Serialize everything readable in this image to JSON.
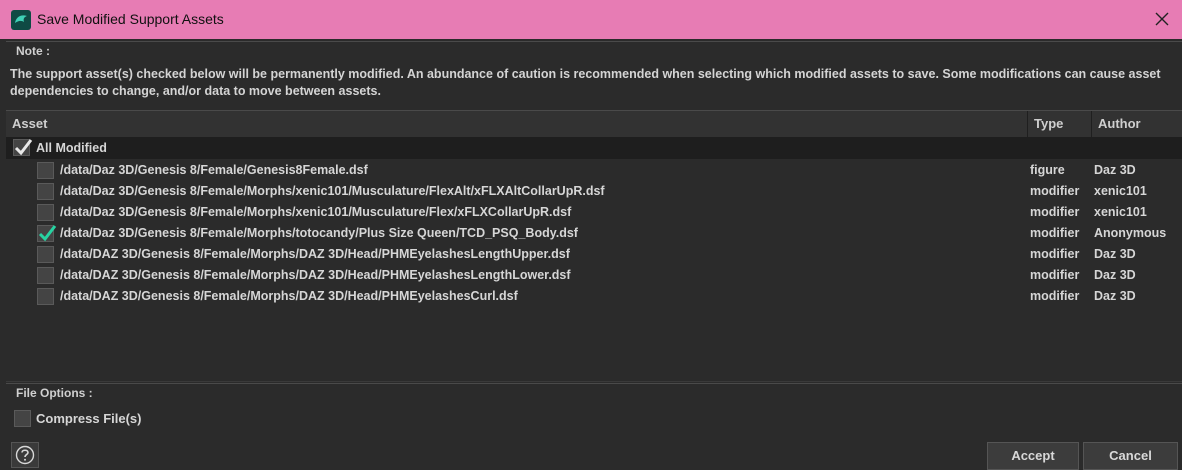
{
  "window": {
    "title": "Save Modified Support Assets",
    "close_icon": "close-icon"
  },
  "note": {
    "label": "Note :",
    "text": "The support asset(s) checked below will be permanently modified. An abundance of caution is recommended when selecting which modified assets to save. Some modifications can cause asset dependencies to change, and/or data to move between assets."
  },
  "table": {
    "headers": {
      "asset": "Asset",
      "type": "Type",
      "author": "Author"
    },
    "all_modified": {
      "label": "All Modified",
      "checked": true
    },
    "rows": [
      {
        "path": "/data/Daz 3D/Genesis 8/Female/Genesis8Female.dsf",
        "type": "figure",
        "author": "Daz 3D",
        "checked": false
      },
      {
        "path": "/data/Daz 3D/Genesis 8/Female/Morphs/xenic101/Musculature/FlexAlt/xFLXAltCollarUpR.dsf",
        "type": "modifier",
        "author": "xenic101",
        "checked": false
      },
      {
        "path": "/data/Daz 3D/Genesis 8/Female/Morphs/xenic101/Musculature/Flex/xFLXCollarUpR.dsf",
        "type": "modifier",
        "author": "xenic101",
        "checked": false
      },
      {
        "path": "/data/Daz 3D/Genesis 8/Female/Morphs/totocandy/Plus Size Queen/TCD_PSQ_Body.dsf",
        "type": "modifier",
        "author": "Anonymous",
        "checked": true
      },
      {
        "path": "/data/DAZ 3D/Genesis 8/Female/Morphs/DAZ 3D/Head/PHMEyelashesLengthUpper.dsf",
        "type": "modifier",
        "author": "Daz 3D",
        "checked": false
      },
      {
        "path": "/data/DAZ 3D/Genesis 8/Female/Morphs/DAZ 3D/Head/PHMEyelashesLengthLower.dsf",
        "type": "modifier",
        "author": "Daz 3D",
        "checked": false
      },
      {
        "path": "/data/DAZ 3D/Genesis 8/Female/Morphs/DAZ 3D/Head/PHMEyelashesCurl.dsf",
        "type": "modifier",
        "author": "Daz 3D",
        "checked": false
      }
    ]
  },
  "file_options": {
    "label": "File Options :",
    "compress_label": "Compress File(s)",
    "compress_checked": false
  },
  "footer": {
    "accept_label": "Accept",
    "cancel_label": "Cancel",
    "help_icon": "help-icon"
  },
  "colors": {
    "titlebar": "#e77cb4",
    "check_green": "#27d3a2",
    "check_white": "#e8e8e8",
    "background": "#2b2b2b"
  }
}
